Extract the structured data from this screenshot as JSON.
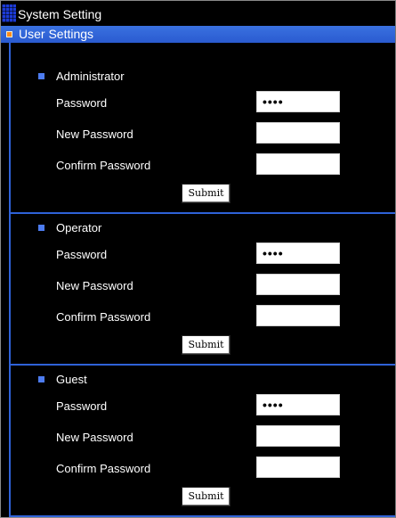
{
  "header": {
    "title": "System Setting",
    "section": "User Settings"
  },
  "accounts": [
    {
      "name": "Administrator",
      "password_label": "Password",
      "password_value": "••••",
      "new_password_label": "New Password",
      "new_password_value": "",
      "confirm_password_label": "Confirm Password",
      "confirm_password_value": "",
      "submit_label": "Submit"
    },
    {
      "name": "Operator",
      "password_label": "Password",
      "password_value": "••••",
      "new_password_label": "New Password",
      "new_password_value": "",
      "confirm_password_label": "Confirm Password",
      "confirm_password_value": "",
      "submit_label": "Submit"
    },
    {
      "name": "Guest",
      "password_label": "Password",
      "password_value": "••••",
      "new_password_label": "New Password",
      "new_password_value": "",
      "confirm_password_label": "Confirm Password",
      "confirm_password_value": "",
      "submit_label": "Submit"
    }
  ],
  "colors": {
    "background": "#000000",
    "section_bar": "#2f62d8",
    "section_bullet": "#ff8a1a",
    "account_bullet": "#4d7cf0",
    "divider": "#2f62d8"
  },
  "icons": {
    "title_icon": "grid-icon",
    "section_icon": "orange-square-bullet-icon",
    "account_icon": "blue-square-bullet-icon"
  }
}
